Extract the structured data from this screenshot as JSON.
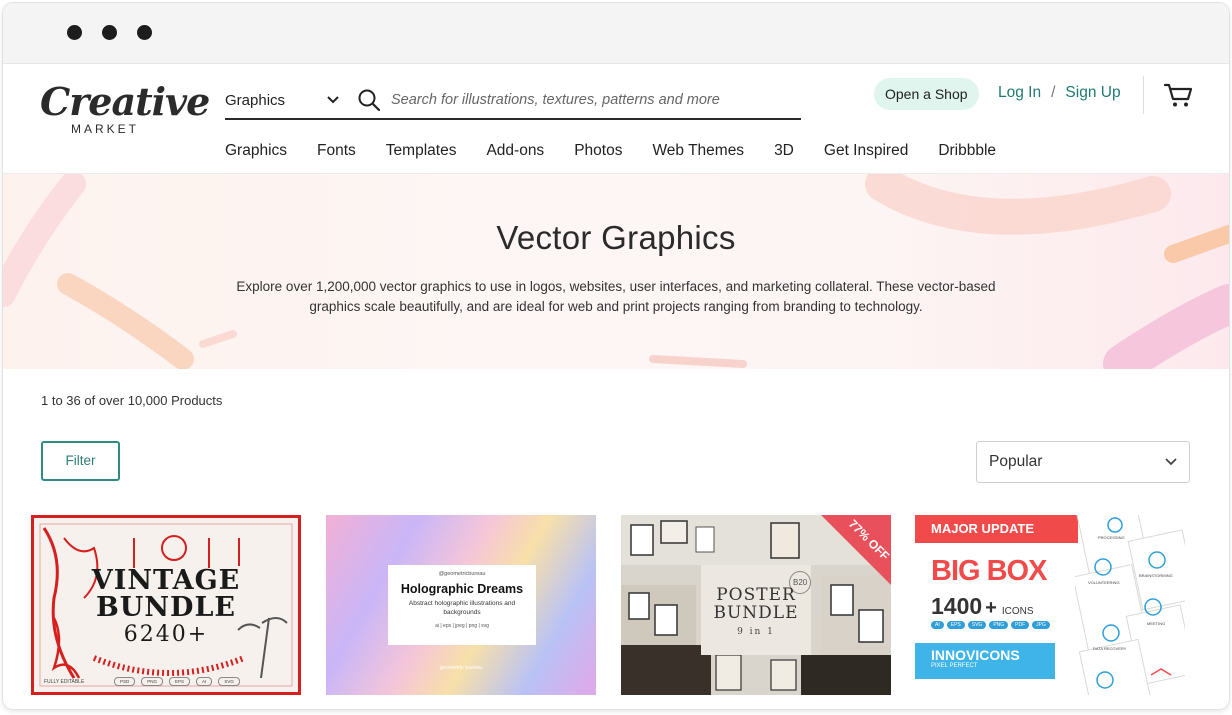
{
  "header": {
    "logo_top": "Creative",
    "logo_bottom": "MARKET",
    "category": "Graphics",
    "search_placeholder": "Search for illustrations, textures, patterns and more",
    "open_shop": "Open a Shop",
    "login": "Log In",
    "separator": "/",
    "signup": "Sign Up"
  },
  "nav": [
    "Graphics",
    "Fonts",
    "Templates",
    "Add-ons",
    "Photos",
    "Web Themes",
    "3D",
    "Get Inspired",
    "Dribbble"
  ],
  "hero": {
    "title": "Vector Graphics",
    "line1": "Explore over 1,200,000 vector graphics to use in logos, websites, user interfaces, and marketing collateral. These vector-based",
    "line2": "graphics scale beautifully, and are ideal for web and print projects ranging from branding to technology."
  },
  "results": {
    "count": "1 to 36 of over 10,000 Products",
    "filter": "Filter",
    "sort": "Popular"
  },
  "cards": [
    {
      "line1": "VINTAGE",
      "line2": "BUNDLE",
      "line3": "6240+",
      "tag": "FULLY EDITABLE",
      "formats": [
        "PSD",
        "PNG",
        "EPS",
        "AI",
        "SVG"
      ]
    },
    {
      "handle": "@geometricbureau",
      "title": "Holographic Dreams",
      "subtitle": "Abstract holographic illustrations and backgrounds",
      "formats": "ai | eps | jpeg | png | svg",
      "footer": "geometric bureau"
    },
    {
      "line1": "POSTER",
      "line2": "BUNDLE",
      "line3": "9 in 1",
      "badge": "77% OFF",
      "stamp": "B20"
    },
    {
      "banner": "MAJOR UPDATE",
      "big": "BIG BOX",
      "count": "1400",
      "plus": "+",
      "icons": "ICONS",
      "formats": [
        "AI",
        "EPS",
        "SVG",
        "PNG",
        "PDF",
        "JPG"
      ],
      "brand": "INNOVICONS",
      "brand_sub": "PIXEL PERFECT",
      "labels": [
        "PROCESSING",
        "VOLUNTEERING",
        "BRAINSTORMING",
        "MEETING",
        "DATA RECOVERY"
      ]
    }
  ],
  "colors": {
    "accent": "#2e8b82",
    "link": "#1f7a73",
    "open_shop_bg": "#e1f5ef",
    "highlight": "#d62020"
  }
}
